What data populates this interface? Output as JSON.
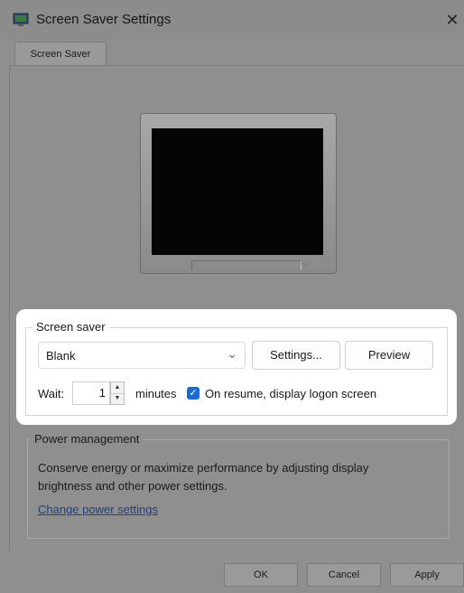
{
  "window": {
    "title": "Screen Saver Settings",
    "close_glyph": "✕",
    "icon": "monitor-app-icon"
  },
  "tabs": [
    {
      "label": "Screen Saver",
      "selected": true
    }
  ],
  "screen_saver": {
    "group_label": "Screen saver",
    "selected": "Blank",
    "settings_label": "Settings...",
    "preview_label": "Preview",
    "wait_label": "Wait:",
    "wait_value": "1",
    "minutes_label": "minutes",
    "resume_checked": true,
    "resume_label": "On resume, display logon screen"
  },
  "power_management": {
    "group_label": "Power management",
    "description": "Conserve energy or maximize performance by adjusting display brightness and other power settings.",
    "link_label": "Change power settings"
  },
  "footer": {
    "ok_label": "OK",
    "cancel_label": "Cancel",
    "apply_label": "Apply"
  },
  "colors": {
    "accent": "#1b6ad3",
    "dim_background": "#8f8f8f",
    "highlight_background": "#ffffff"
  }
}
